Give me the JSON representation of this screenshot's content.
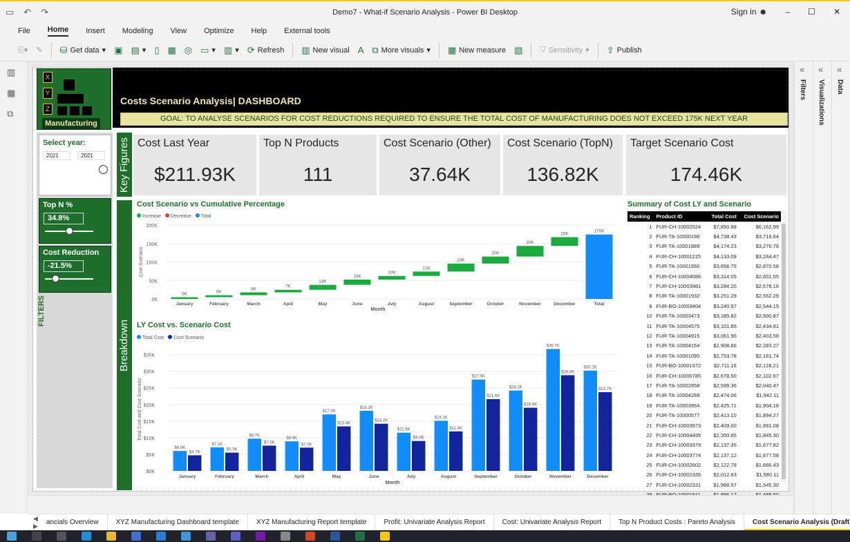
{
  "window": {
    "title": "Demo7 - What-if Scenario Analysis - Power BI Desktop",
    "sign_in": "Sign in"
  },
  "menu": [
    "File",
    "Home",
    "Insert",
    "Modeling",
    "View",
    "Optimize",
    "Help",
    "External tools"
  ],
  "ribbon": {
    "get_data": "Get data",
    "refresh": "Refresh",
    "new_visual": "New visual",
    "more_visuals": "More visuals",
    "new_measure": "New measure",
    "sensitivity": "Sensitivity",
    "publish": "Publish"
  },
  "panes": {
    "filters": "Filters",
    "visualizations": "Visualizations",
    "data": "Data"
  },
  "dashboard": {
    "logo": {
      "letters": [
        "X",
        "Y",
        "Z"
      ],
      "label": "Manufacturing"
    },
    "title": "Costs Scenario Analysis| DASHBOARD",
    "goal": "GOAL: TO ANALYSE SCENARIOS FOR COST REDUCTIONS REQUIRED TO ENSURE THE TOTAL COST OF MANUFACTURING DOES NOT EXCEED 175K NEXT YEAR"
  },
  "filters": {
    "label": "FILTERS",
    "year": {
      "label": "Select year:",
      "from": "2021",
      "to": "2021"
    },
    "topn": {
      "label": "Top N %",
      "value": "34.8%",
      "level": 0.5
    },
    "reduction": {
      "label": "Cost Reduction",
      "value": "-21.5%",
      "level": 0.22
    }
  },
  "strips": {
    "key_figures": "Key Figures",
    "breakdown": "Breakdown"
  },
  "kpis": [
    {
      "title": "Cost Last Year",
      "value": "$211.93K"
    },
    {
      "title": "Top N Products",
      "value": "111"
    },
    {
      "title": "Cost Scenario (Other)",
      "value": "37.64K"
    },
    {
      "title": "Cost Scenario (TopN)",
      "value": "136.82K"
    },
    {
      "title": "Target Scenario Cost",
      "value": "174.46K"
    }
  ],
  "chart_data": [
    {
      "type": "bar",
      "subtype": "waterfall",
      "title": "Cost Scenario vs Cumulative Percentage",
      "legend": [
        {
          "name": "Increase",
          "color": "#1aab40"
        },
        {
          "name": "Decrease",
          "color": "#e6374a"
        },
        {
          "name": "Total",
          "color": "#118dff"
        }
      ],
      "xlabel": "Month",
      "ylabel": "Cost Scenario",
      "yticks": [
        "0K",
        "50K",
        "100K",
        "150K",
        "200K"
      ],
      "ylim": [
        0,
        200
      ],
      "categories": [
        "January",
        "February",
        "March",
        "April",
        "May",
        "June",
        "July",
        "August",
        "September",
        "October",
        "November",
        "December",
        "Total"
      ],
      "values": [
        4.7,
        5.5,
        7.6,
        7.0,
        13.4,
        14.2,
        9.9,
        11.9,
        21.6,
        19.0,
        28.8,
        23.7,
        174.5
      ],
      "labels": [
        "5K",
        "6K",
        "8K",
        "7K",
        "14K",
        "15K",
        "10K",
        "12K",
        "23K",
        "20K",
        "30K",
        "25K",
        "175K"
      ],
      "colors": {
        "increase": "#1aab40",
        "total": "#118dff"
      }
    },
    {
      "type": "bar",
      "title": "LY Cost vs. Scenario Cost",
      "xlabel": "Month",
      "ylabel": "Total Cost and Cost Scenario",
      "yticks": [
        "$0K",
        "$5K",
        "$10K",
        "$15K",
        "$20K",
        "$25K",
        "$30K",
        "$35K"
      ],
      "ylim": [
        0,
        37
      ],
      "categories": [
        "January",
        "February",
        "March",
        "April",
        "May",
        "June",
        "July",
        "August",
        "September",
        "October",
        "November",
        "December"
      ],
      "series": [
        {
          "name": "Total Cost",
          "color": "#118dff",
          "values": [
            6.0,
            7.1,
            9.7,
            8.9,
            17.0,
            18.1,
            11.5,
            15.1,
            27.5,
            24.2,
            36.7,
            30.2
          ],
          "labels": [
            "$6.0K",
            "$7.1K",
            "$9.7K",
            "$8.9K",
            "$17.0K",
            "$18.1K",
            "$11.5K",
            "$15.1K",
            "$27.5K",
            "$24.2K",
            "$36.7K",
            "$30.2K"
          ]
        },
        {
          "name": "Cost Scenario",
          "color": "#12239e",
          "values": [
            4.7,
            5.5,
            7.6,
            7.0,
            13.4,
            14.2,
            9.0,
            11.9,
            21.6,
            19.0,
            28.8,
            23.7
          ],
          "labels": [
            "$4.7K",
            "$5.5K",
            "$7.6K",
            "$7.0K",
            "$13.4K",
            "$14.2K",
            "$9.0K",
            "$11.9K",
            "$21.6K",
            "$19.0K",
            "$28.8K",
            "$23.7K"
          ]
        }
      ]
    }
  ],
  "summary": {
    "title": "Summary of Cost LY and Scenario",
    "columns": [
      "Ranking",
      "Product ID",
      "Total Cost",
      "Cost Scenario"
    ],
    "rows": [
      [
        "1",
        "FUR-CH-10002024",
        "$7,850.98",
        "$6,162.99"
      ],
      [
        "2",
        "FUR-TA-10000198",
        "$4,738.43",
        "$3,719.64"
      ],
      [
        "3",
        "FUR-TA-10001889",
        "$4,174.23",
        "$3,276.76"
      ],
      [
        "4",
        "FUR-CH-10001215",
        "$4,133.09",
        "$3,244.47"
      ],
      [
        "5",
        "FUR-TA-10001950",
        "$3,656.75",
        "$2,870.58"
      ],
      [
        "6",
        "FUR-CH-10004086",
        "$3,314.05",
        "$2,601.55"
      ],
      [
        "7",
        "FUR-CH-10003981",
        "$3,284.20",
        "$2,578.16"
      ],
      [
        "8",
        "FUR-TA-10001932",
        "$3,251.29",
        "$2,552.29"
      ],
      [
        "9",
        "FUR-BO-10003404",
        "$3,240.97",
        "$2,544.15"
      ],
      [
        "10",
        "FUR-TA-10003473",
        "$3,185.82",
        "$2,500.87"
      ],
      [
        "11",
        "FUR-TA-10004575",
        "$3,101.85",
        "$2,434.91"
      ],
      [
        "12",
        "FUR-TA-10004915",
        "$3,061.90",
        "$2,403.58"
      ],
      [
        "13",
        "FUR-TA-10004154",
        "$2,908.66",
        "$2,283.27"
      ],
      [
        "14",
        "FUR-TA-10001095",
        "$2,753.78",
        "$2,161.74"
      ],
      [
        "15",
        "FUR-BO-10001972",
        "$2,711.16",
        "$2,128.21"
      ],
      [
        "16",
        "FUR-CH-10000785",
        "$2,678.50",
        "$2,102.67"
      ],
      [
        "17",
        "FUR-TA-10002958",
        "$2,599.36",
        "$2,040.47"
      ],
      [
        "18",
        "FUR-TA-10004289",
        "$2,474.06",
        "$1,942.11"
      ],
      [
        "19",
        "FUR-TA-10003954",
        "$2,425.71",
        "$1,904.16"
      ],
      [
        "20",
        "FUR-TA-10000577",
        "$2,413.10",
        "$1,894.27"
      ],
      [
        "21",
        "FUR-CH-10003973",
        "$2,409.00",
        "$1,891.08"
      ],
      [
        "22",
        "FUR-CH-10004495",
        "$2,350.65",
        "$1,845.30"
      ],
      [
        "23",
        "FUR-CH-10003379",
        "$2,137.35",
        "$1,677.82"
      ],
      [
        "24",
        "FUR-CH-10003774",
        "$2,137.12",
        "$1,677.58"
      ],
      [
        "25",
        "FUR-CH-10002602",
        "$2,122.78",
        "$1,666.43"
      ],
      [
        "26",
        "FUR-CH-10002335",
        "$2,012.83",
        "$1,580.11"
      ],
      [
        "27",
        "FUR-CH-10002331",
        "$1,968.57",
        "$1,545.30"
      ],
      [
        "28",
        "FUR-BO-10001811",
        "$1,896.17",
        "$1,488.50"
      ]
    ]
  },
  "tabs": [
    {
      "label": "ancials Overview",
      "active": false
    },
    {
      "label": "XYZ Manufacturing Dashboard template",
      "active": false
    },
    {
      "label": "XYZ Manufacturing Report template",
      "active": false
    },
    {
      "label": "Profit: Univariate Analysis Report",
      "active": false
    },
    {
      "label": "Cost: Univariate Analysis Report",
      "active": false
    },
    {
      "label": "Top N Product Costs : Pareto Analysis",
      "active": false
    },
    {
      "label": "Cost Scenario Analysis (Draft)",
      "active": true
    }
  ]
}
